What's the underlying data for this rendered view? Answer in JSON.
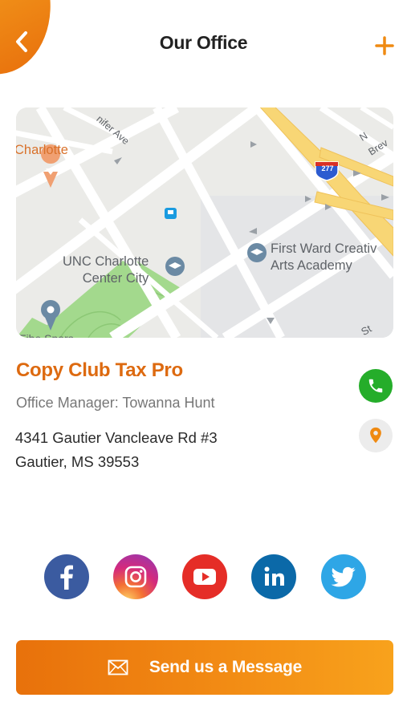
{
  "header": {
    "title": "Our Office"
  },
  "map": {
    "labels": {
      "city": "Charlotte",
      "street_a": "nifer Ave",
      "street_b": "N Brev",
      "street_c": "St",
      "highway": "277",
      "poi_university": "UNC Charlotte",
      "poi_university_line2": "Center City",
      "poi_academy": "First Ward Creativ",
      "poi_academy_line2": "Arts Academy",
      "cutoff": "Fibe Spars"
    }
  },
  "office": {
    "name": "Copy Club Tax Pro",
    "manager": "Office Manager: Towanna Hunt",
    "address_line1": "4341 Gautier Vancleave Rd #3",
    "address_line2": "Gautier, MS 39553"
  },
  "social": [
    {
      "name": "facebook-icon",
      "color": "#3b5ba0"
    },
    {
      "name": "instagram-icon",
      "color": "#c13584"
    },
    {
      "name": "youtube-icon",
      "color": "#e52d27"
    },
    {
      "name": "linkedin-icon",
      "color": "#0b69a8"
    },
    {
      "name": "twitter-icon",
      "color": "#2ea6e6"
    }
  ],
  "actions": {
    "send_label": "Send us a Message"
  },
  "colors": {
    "accent": "#e8710b",
    "call": "#25ad2a",
    "office_name": "#dd6a10"
  }
}
